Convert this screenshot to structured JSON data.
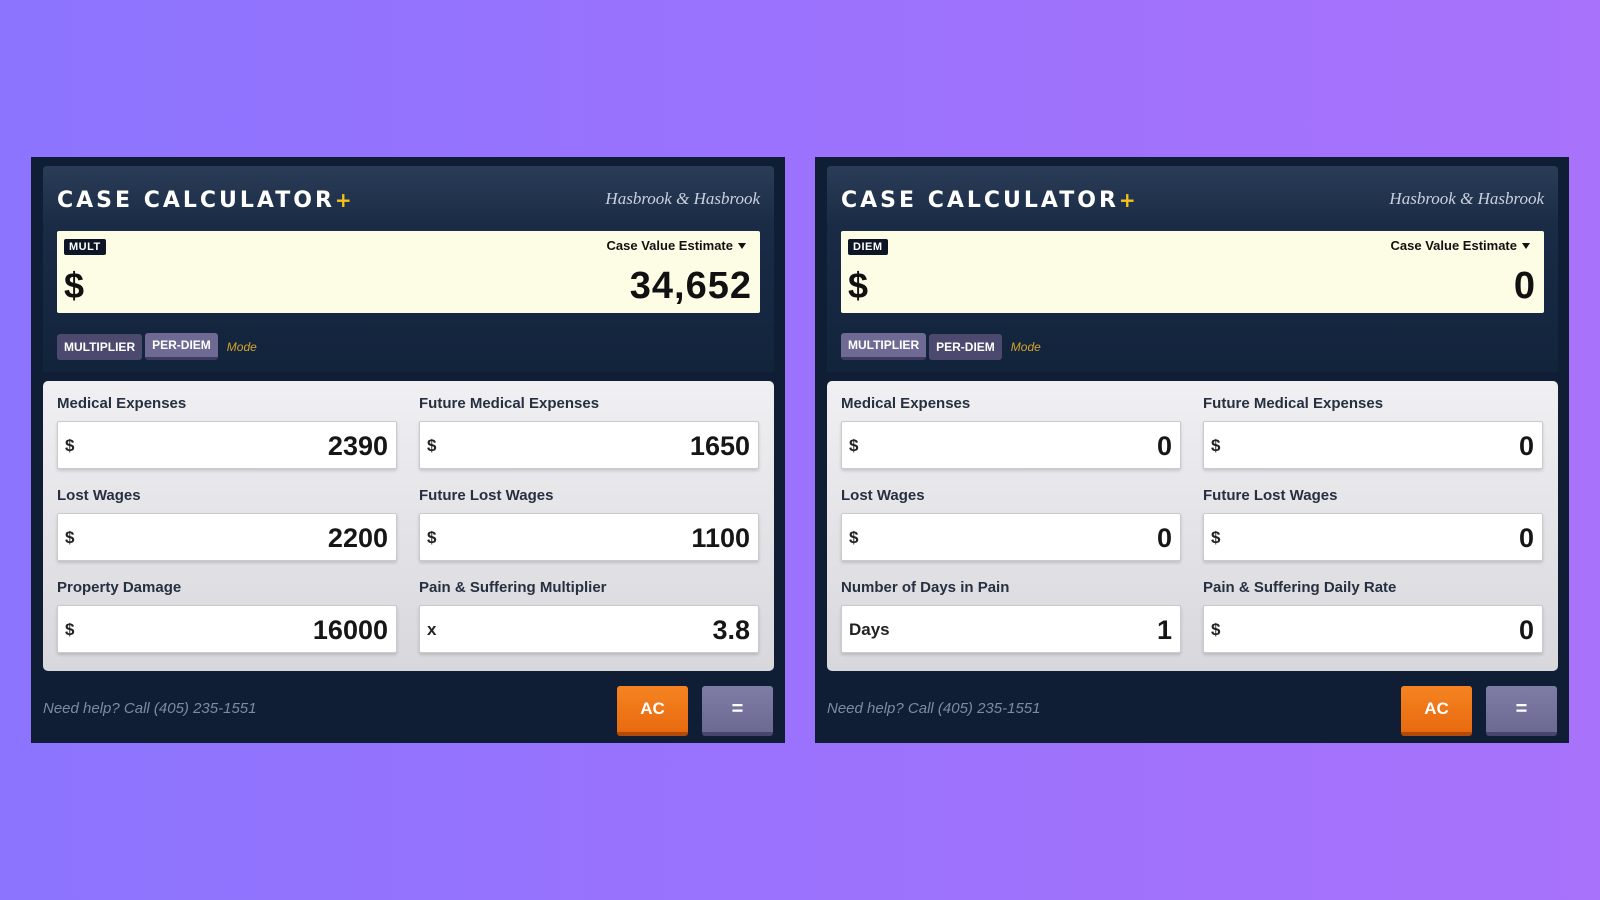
{
  "calculators": [
    {
      "title": "Case Calculator",
      "title_plus": "+",
      "firm": "Hasbrook & Hasbrook",
      "badge": "MULT",
      "estimate_label": "Case Value Estimate",
      "currency": "$",
      "total": "34,652",
      "modes": {
        "multiplier": "MULTIPLIER",
        "per_diem": "PER-DIEM",
        "label": "Mode",
        "active": "per_diem"
      },
      "fields": [
        {
          "label": "Medical Expenses",
          "prefix": "$",
          "value": "2390"
        },
        {
          "label": "Future Medical Expenses",
          "prefix": "$",
          "value": "1650"
        },
        {
          "label": "Lost Wages",
          "prefix": "$",
          "value": "2200"
        },
        {
          "label": "Future Lost Wages",
          "prefix": "$",
          "value": "1100"
        },
        {
          "label": "Property Damage",
          "prefix": "$",
          "value": "16000"
        },
        {
          "label": "Pain & Suffering Multiplier",
          "prefix": "x",
          "value": "3.8"
        }
      ],
      "help": "Need help? Call (405) 235-1551",
      "ac_label": "AC",
      "equals_label": "="
    },
    {
      "title": "Case Calculator",
      "title_plus": "+",
      "firm": "Hasbrook & Hasbrook",
      "badge": "DIEM",
      "estimate_label": "Case Value Estimate",
      "currency": "$",
      "total": "0",
      "modes": {
        "multiplier": "MULTIPLIER",
        "per_diem": "PER-DIEM",
        "label": "Mode",
        "active": "multiplier"
      },
      "fields": [
        {
          "label": "Medical Expenses",
          "prefix": "$",
          "value": "0"
        },
        {
          "label": "Future Medical Expenses",
          "prefix": "$",
          "value": "0"
        },
        {
          "label": "Lost Wages",
          "prefix": "$",
          "value": "0"
        },
        {
          "label": "Future Lost Wages",
          "prefix": "$",
          "value": "0"
        },
        {
          "label": "Number of Days in Pain",
          "prefix": "Days",
          "value": "1"
        },
        {
          "label": "Pain & Suffering Daily Rate",
          "prefix": "$",
          "value": "0"
        }
      ],
      "help": "Need help? Call (405) 235-1551",
      "ac_label": "AC",
      "equals_label": "="
    }
  ],
  "colors": {
    "background": "#9b72fd",
    "panel": "#0f1e35",
    "display": "#fdfde6",
    "accent_plus": "#f5c21b",
    "ac_button": "#f58420",
    "equals_button": "#7f7da6",
    "mode_label": "#d4a42d"
  }
}
